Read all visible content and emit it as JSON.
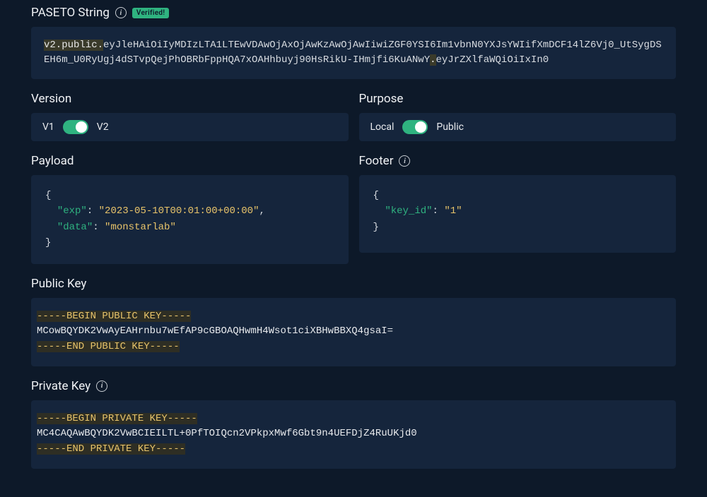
{
  "pasetoString": {
    "label": "PASETO String",
    "badge": "Verified!",
    "prefix": "v2.public.",
    "payload": "eyJleHAiOiIyMDIzLTA1LTEwVDAwOjAxOjAwKzAwOjAwIiwiZGF0YSI6Im1vbnN0YXJsYWIifXmDCF14lZ6Vj0_UtSygDSEH6m_U0RyUgj4dSTvpQejPhOBRbFppHQA7xOAHhbuyj90HsRikU-IHmjfi6KuANwY",
    "footer_sep": ".",
    "footer": "eyJrZXlfaWQiOiIxIn0"
  },
  "version": {
    "label": "Version",
    "left": "V1",
    "right": "V2"
  },
  "purpose": {
    "label": "Purpose",
    "left": "Local",
    "right": "Public"
  },
  "payload": {
    "label": "Payload",
    "json": {
      "k1": "\"exp\"",
      "v1": "\"2023-05-10T00:01:00+00:00\"",
      "k2": "\"data\"",
      "v2": "\"monstarlab\""
    }
  },
  "footer": {
    "label": "Footer",
    "json": {
      "k1": "\"key_id\"",
      "v1": "\"1\""
    }
  },
  "publicKey": {
    "label": "Public Key",
    "begin": "-----BEGIN PUBLIC KEY-----",
    "body": "MCowBQYDK2VwAyEAHrnbu7wEfAP9cGBOAQHwmH4Wsot1ciXBHwBBXQ4gsaI=",
    "end": "-----END PUBLIC KEY-----"
  },
  "privateKey": {
    "label": "Private Key",
    "begin": "-----BEGIN PRIVATE KEY-----",
    "body": "MC4CAQAwBQYDK2VwBCIEILTL+0PfTOIQcn2VPkpxMwf6Gbt9n4UEFDjZ4RuUKjd0",
    "end": "-----END PRIVATE KEY-----"
  }
}
